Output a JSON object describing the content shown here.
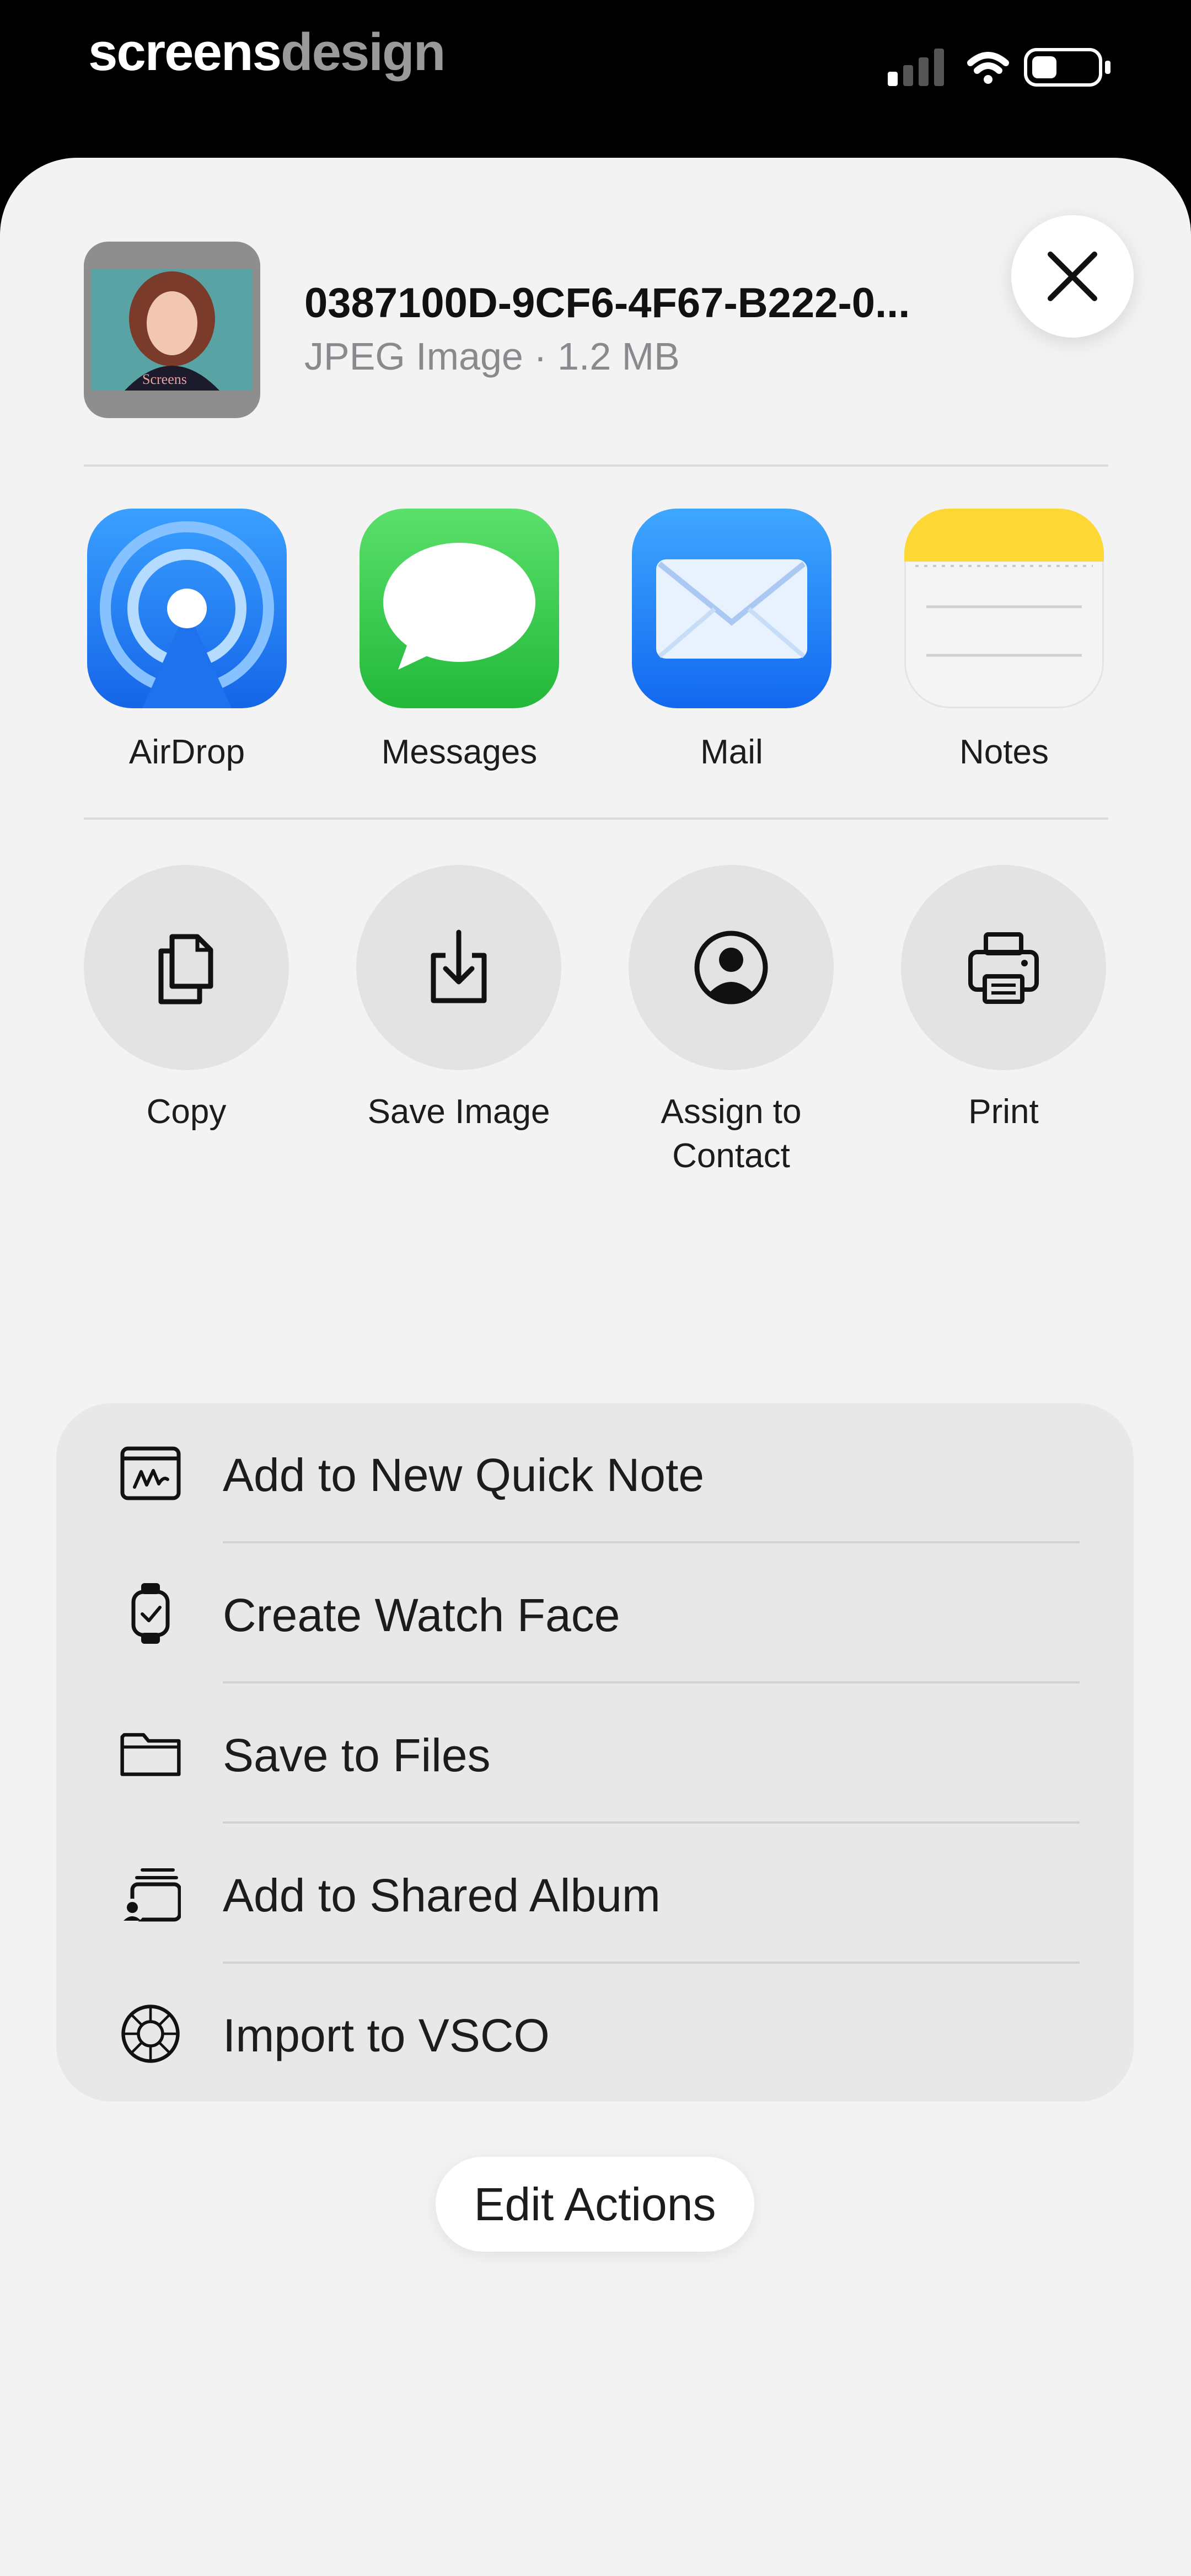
{
  "status_bar": {
    "brand_part1": "screens",
    "brand_part2": "design"
  },
  "header": {
    "file_name": "0387100D-9CF6-4F67-B222-0...",
    "file_info": "JPEG Image · 1.2 MB",
    "thumbnail_caption": "Screens"
  },
  "apps": [
    {
      "label": "AirDrop",
      "icon": "airdrop-icon"
    },
    {
      "label": "Messages",
      "icon": "messages-icon"
    },
    {
      "label": "Mail",
      "icon": "mail-icon"
    },
    {
      "label": "Notes",
      "icon": "notes-icon"
    }
  ],
  "quick_actions": [
    {
      "label": "Copy",
      "icon": "copy-icon"
    },
    {
      "label": "Save Image",
      "icon": "save-image-icon"
    },
    {
      "label": "Assign to Contact",
      "icon": "contact-icon"
    },
    {
      "label": "Print",
      "icon": "printer-icon"
    }
  ],
  "actions": [
    {
      "label": "Add to New Quick Note",
      "icon": "quick-note-icon"
    },
    {
      "label": "Create Watch Face",
      "icon": "watch-icon"
    },
    {
      "label": "Save to Files",
      "icon": "folder-icon"
    },
    {
      "label": "Add to Shared Album",
      "icon": "shared-album-icon"
    },
    {
      "label": "Import to VSCO",
      "icon": "vsco-icon"
    }
  ],
  "edit_actions_label": "Edit Actions",
  "colors": {
    "sheet_background": "#f3f3f3",
    "list_background": "#e8e8e8",
    "airdrop_blue": "#1a7cf5",
    "messages_green": "#34c759",
    "mail_blue": "#2a8ef7",
    "notes_yellow": "#fdd835"
  }
}
